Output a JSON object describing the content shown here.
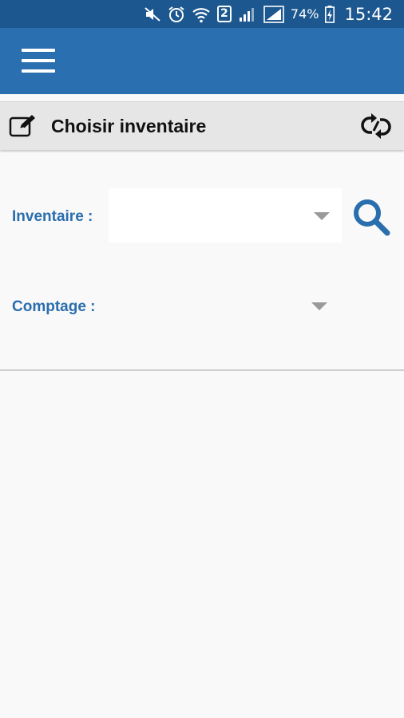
{
  "status_bar": {
    "icons": [
      "mute-icon",
      "alarm-icon",
      "wifi-icon",
      "sim-icon",
      "signal-icon",
      "signal-icon",
      "battery-charging-icon"
    ],
    "sim_slot": "2",
    "battery_percent": "74%",
    "time": "15:42"
  },
  "app_bar": {
    "menu_icon": "hamburger-menu-icon",
    "background": "#2a70b0"
  },
  "section": {
    "title": "Choisir inventaire",
    "left_icon": "edit-icon",
    "right_icon": "sync-icon"
  },
  "form": {
    "inventaire_label": "Inventaire :",
    "inventaire_value": "",
    "comptage_label": "Comptage :",
    "comptage_value": "",
    "search_icon": "search-icon",
    "accent": "#2a6eae"
  }
}
